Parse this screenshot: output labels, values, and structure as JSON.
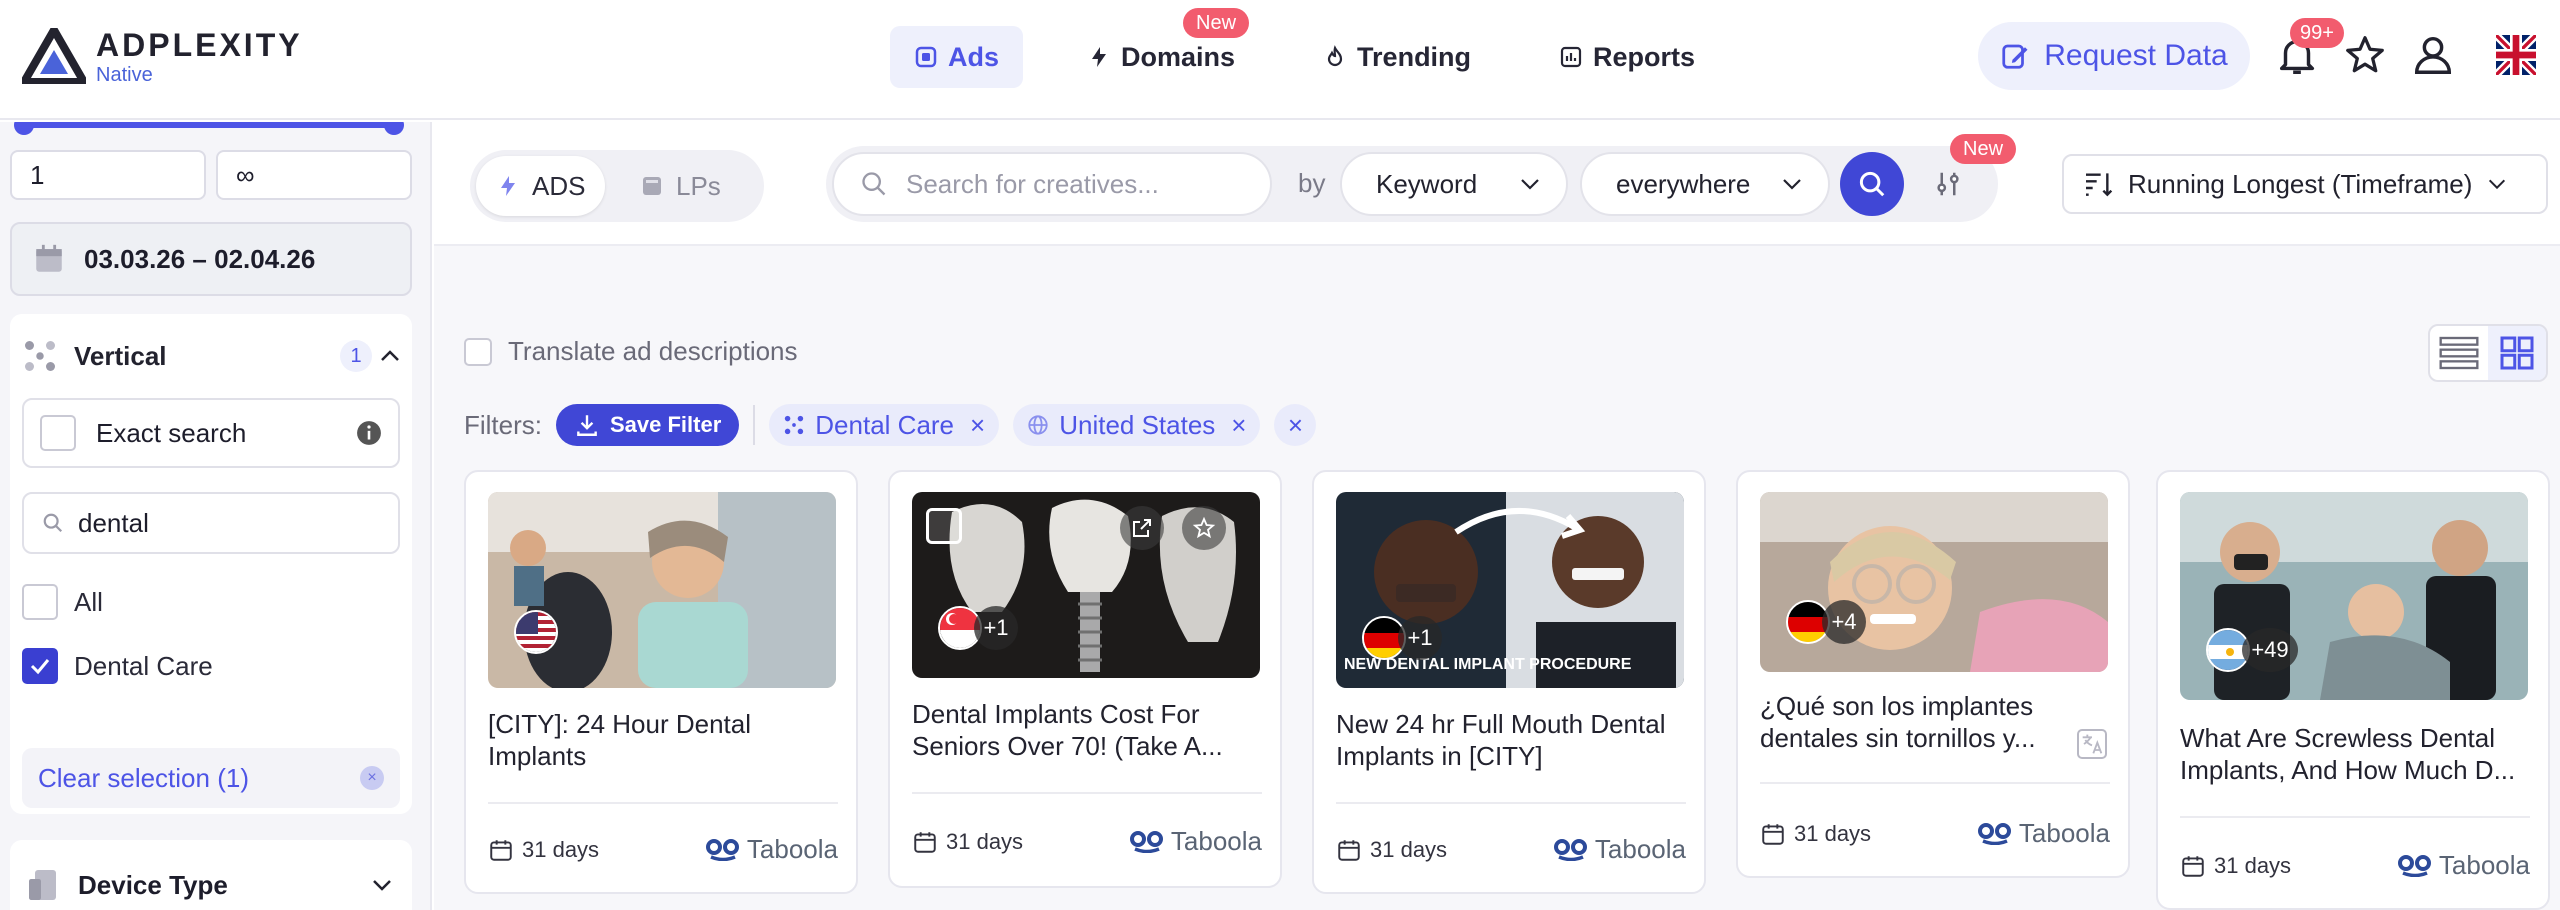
{
  "brand": {
    "name": "ADPLEXITY",
    "sub": "Native"
  },
  "nav": [
    {
      "label": "Ads",
      "active": true
    },
    {
      "label": "Domains",
      "badge": "New"
    },
    {
      "label": "Trending"
    },
    {
      "label": "Reports"
    }
  ],
  "header": {
    "request_data": "Request Data",
    "notifications": "99+"
  },
  "sidebar": {
    "range_min": "1",
    "range_max": "∞",
    "date_range": "03.03.26 – 02.04.26",
    "vertical": {
      "title": "Vertical",
      "count": "1",
      "exact_search": "Exact search",
      "search_value": "dental",
      "option_all": "All",
      "option_dental": "Dental Care",
      "clear": "Clear selection (1)"
    },
    "device_type": "Device Type"
  },
  "toolbar": {
    "seg_ads": "ADS",
    "seg_lps": "LPs",
    "search_placeholder": "Search for creatives...",
    "by": "by",
    "keyword": "Keyword",
    "scope": "everywhere",
    "filter_badge": "New",
    "sort": "Running Longest (Timeframe)"
  },
  "translate_label": "Translate ad descriptions",
  "filters": {
    "label": "Filters:",
    "save": "Save Filter",
    "chips": [
      "Dental Care",
      "United States"
    ]
  },
  "cards": [
    {
      "title": "[CITY]: 24 Hour Dental Implants",
      "days": "31 days",
      "network": "Taboola",
      "plus": ""
    },
    {
      "title": "Dental Implants Cost For Seniors Over 70! (Take A...",
      "days": "31 days",
      "network": "Taboola",
      "plus": "+1"
    },
    {
      "title": "New 24 hr Full Mouth Dental Implants in [CITY]",
      "days": "31 days",
      "network": "Taboola",
      "plus": "+1",
      "overlay": "NEW DENTAL IMPLANT PROCEDURE"
    },
    {
      "title": "¿Qué son los implantes dentales sin tornillos y...",
      "days": "31 days",
      "network": "Taboola",
      "plus": "+4"
    },
    {
      "title": "What Are Screwless Dental Implants, And How Much D...",
      "days": "31 days",
      "network": "Taboola",
      "plus": "+49"
    }
  ],
  "colors": {
    "accent": "#4d54e6",
    "badge": "#f25c6e",
    "taboola": "#2c4a9a"
  }
}
